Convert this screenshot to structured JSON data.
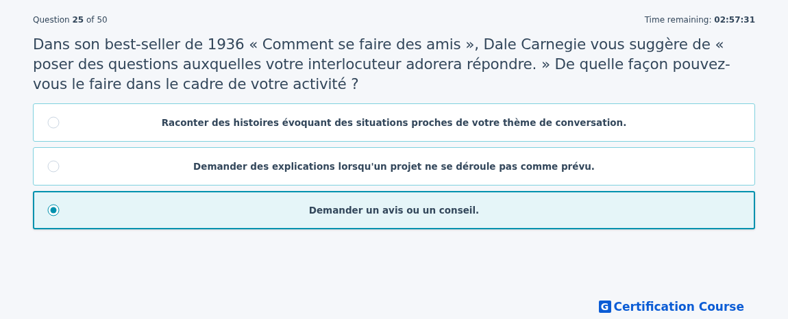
{
  "header": {
    "progress": "Question **25** of 50",
    "timer": "Time remaining: **02:57:31**"
  },
  "question": "Dans son best-seller de 1936 « Comment se faire des amis », Dale Carnegie vous suggère de « poser des questions auxquelles votre interlocuteur adorera répondre. » De quelle façon pouvez-vous le faire dans le cadre de votre activité ?",
  "options": [
    {
      "label": "Raconter des histoires évoquant des situations proches de votre thème de conversation.",
      "selected": false
    },
    {
      "label": "Demander des explications lorsqu'un projet ne se déroule pas comme prévu.",
      "selected": false
    },
    {
      "label": "Demander un avis ou un conseil.",
      "selected": true
    }
  ],
  "logo": {
    "mark": "G",
    "text": "Certification Course"
  }
}
